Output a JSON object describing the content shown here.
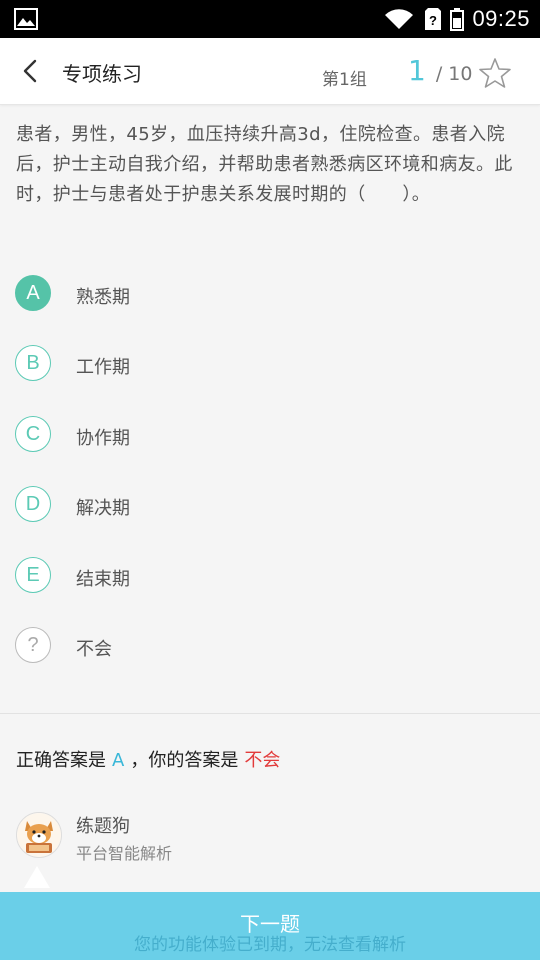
{
  "status_bar": {
    "time": "09:25"
  },
  "header": {
    "title": "专项练习",
    "group": "第1组",
    "current": "1",
    "separator": "/",
    "total": "10"
  },
  "question": "患者，男性，45岁，血压持续升高3d，住院检查。患者入院后，护士主动自我介绍，并帮助患者熟悉病区环境和病友。此时，护士与患者处于护患关系发展时期的（　　）。",
  "options": [
    {
      "key": "A",
      "text": "熟悉期",
      "selected": true
    },
    {
      "key": "B",
      "text": "工作期",
      "selected": false
    },
    {
      "key": "C",
      "text": "协作期",
      "selected": false
    },
    {
      "key": "D",
      "text": "解决期",
      "selected": false
    },
    {
      "key": "E",
      "text": "结束期",
      "selected": false
    },
    {
      "key": "?",
      "text": "不会",
      "selected": false
    }
  ],
  "answer": {
    "prefix": "正确答案是",
    "correct": "A",
    "middle": "，你的答案是",
    "yours": "不会"
  },
  "bot": {
    "name": "练题狗",
    "subtitle": "平台智能解析"
  },
  "next_button": {
    "label": "下一题"
  },
  "expire_note": "您的功能体验已到期，无法查看解析",
  "colors": {
    "accent_teal": "#55c3a8",
    "progress_blue": "#52c7d9",
    "button_blue": "#6acfe8",
    "wrong_red": "#e23b3b"
  }
}
